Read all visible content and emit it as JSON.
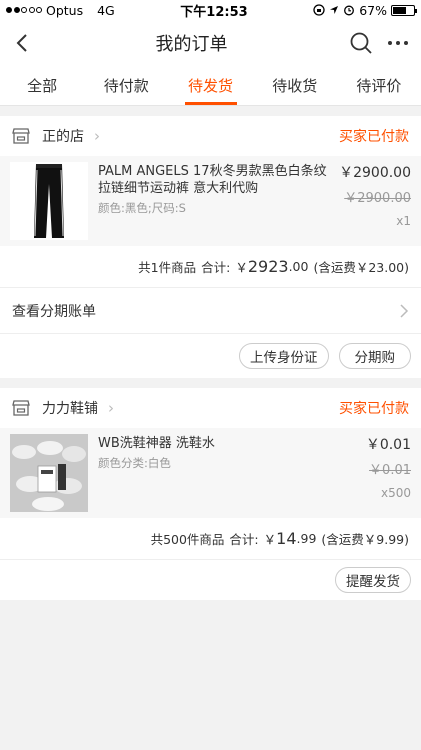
{
  "status_bar": {
    "carrier": "Optus",
    "network": "4G",
    "time": "下午12:53",
    "battery": "67%"
  },
  "nav": {
    "title": "我的订单"
  },
  "tabs": [
    {
      "label": "全部"
    },
    {
      "label": "待付款"
    },
    {
      "label": "待发货",
      "active": true
    },
    {
      "label": "待收货"
    },
    {
      "label": "待评价"
    }
  ],
  "orders": [
    {
      "shop_name": "正的店",
      "status": "买家已付款",
      "item": {
        "title": "PALM ANGELS 17秋冬男款黑色白条纹拉链细节运动裤 意大利代购",
        "spec": "颜色:黑色;尺码:S",
        "price": "￥2900.00",
        "original_price": "￥2900.00",
        "qty": "x1"
      },
      "summary": {
        "count": "共1件商品",
        "total_label": "合计:",
        "currency": "￥",
        "total_int": "2923",
        "total_dec": ".00",
        "shipping": "(含运费￥23.00)"
      },
      "installment_label": "查看分期账单",
      "buttons": [
        "上传身份证",
        "分期购"
      ]
    },
    {
      "shop_name": "力力鞋铺",
      "status": "买家已付款",
      "item": {
        "title": "WB洗鞋神器 洗鞋水",
        "spec": "颜色分类:白色",
        "price": "￥0.01",
        "original_price": "￥0.01",
        "qty": "x500"
      },
      "summary": {
        "count": "共500件商品",
        "total_label": "合计:",
        "currency": "￥",
        "total_int": "14",
        "total_dec": ".99",
        "shipping": "(含运费￥9.99)"
      },
      "buttons": [
        "提醒发货"
      ]
    }
  ],
  "colors": {
    "accent": "#ff5000",
    "background": "#f2f2f2"
  }
}
